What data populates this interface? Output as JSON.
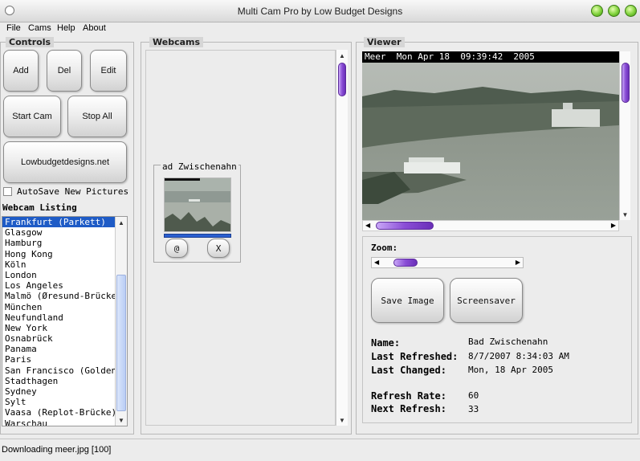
{
  "window": {
    "title": "Multi Cam Pro by Low Budget Designs"
  },
  "menu": [
    "File",
    "Cams",
    "Help",
    "About"
  ],
  "controls": {
    "label": "Controls",
    "add": "Add",
    "del": "Del",
    "edit": "Edit",
    "start_cam": "Start Cam",
    "stop_all": "Stop All",
    "website": "Lowbudgetdesigns.net",
    "autosave_label": "AutoSave New Pictures",
    "autosave_checked": false
  },
  "listing": {
    "label": "Webcam Listing",
    "selected_index": 0,
    "items": [
      "Frankfurt (Parkett)",
      "Glasgow",
      "Hamburg",
      "Hong Kong",
      "Köln",
      "London",
      "Los Angeles",
      "Malmö (Øresund-Brücke",
      "München",
      "Neufundland",
      "New York",
      "Osnabrück",
      "Panama",
      "Paris",
      "San Francisco (Golden G",
      "Stadthagen",
      "Sydney",
      "Sylt",
      "Vaasa (Replot-Brücke)",
      "Warschau"
    ]
  },
  "webcams": {
    "label": "Webcams",
    "card_title": "ad Zwischenahn",
    "link_icon_label": "@",
    "close_icon_label": "X"
  },
  "viewer": {
    "label": "Viewer",
    "caption": "Meer  Mon Apr 18  09:39:42  2005",
    "zoom_label": "Zoom:",
    "zoom_value": 0.1,
    "save_image": "Save Image",
    "screensaver": "Screensaver",
    "name_label": "Name:",
    "name_value": "Bad Zwischenahn",
    "last_refreshed_label": "Last Refreshed:",
    "last_refreshed_value": "8/7/2007 8:34:03 AM",
    "last_changed_label": "Last Changed:",
    "last_changed_value": "Mon, 18 Apr 2005",
    "refresh_rate_label": "Refresh Rate:",
    "refresh_rate_value": "60",
    "next_refresh_label": "Next Refresh:",
    "next_refresh_value": "33"
  },
  "status": {
    "text": "Downloading meer.jpg [100]"
  },
  "colors": {
    "accent_purple": "#8a4ed6",
    "selection_blue": "#1e5bc6",
    "titlebar_green": "#7fd13b"
  }
}
